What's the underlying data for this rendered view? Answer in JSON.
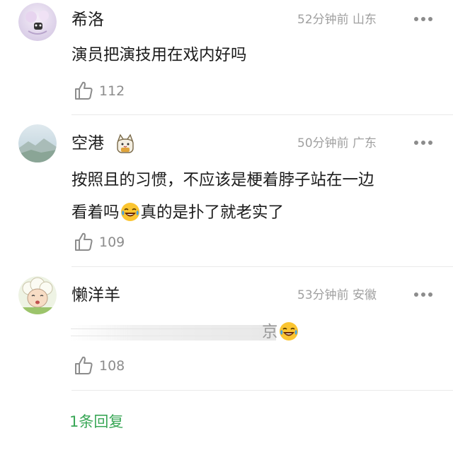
{
  "comments": [
    {
      "username": "希洛",
      "meta": "52分钟前 山东",
      "content": "演员把演技用在戏内好吗",
      "likes": "112"
    },
    {
      "username": "空港",
      "meta": "50分钟前 广东",
      "content_line1": "按照且的习惯，不应该是梗着脖子站在一边",
      "content_line2a": "看着吗",
      "content_line2b": "真的是扑了就老实了",
      "likes": "109"
    },
    {
      "username": "懒洋羊",
      "meta": "53分钟前 安徽",
      "content_tail": "京",
      "likes": "108"
    }
  ],
  "reply_link": "1条回复",
  "colors": {
    "accent_green": "#3aa757",
    "text": "#1c1c1c",
    "muted": "#a0a0a0"
  },
  "icons": [
    "more-dots-icon",
    "thumb-up-icon",
    "laughing-crying-emoji",
    "fortune-cat-badge-icon"
  ]
}
